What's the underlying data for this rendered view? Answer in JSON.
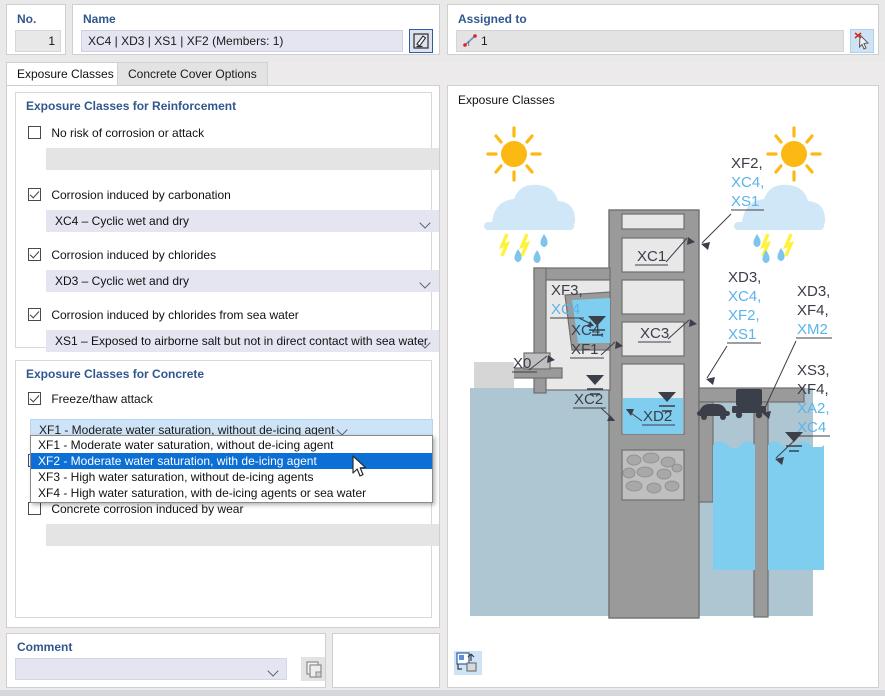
{
  "header": {
    "no_label": "No.",
    "no_value": "1",
    "name_label": "Name",
    "name_value": "XC4 | XD3 | XS1 | XF2 (Members: 1)",
    "name_edit_icon": "pencil-edit-icon",
    "assigned_label": "Assigned to",
    "assigned_value": "1",
    "assigned_member_icon": "member-line-icon",
    "assigned_pick_icon": "pick-cursor-icon"
  },
  "tabs": [
    {
      "label": "Exposure Classes",
      "active": true
    },
    {
      "label": "Concrete Cover Options",
      "active": false
    }
  ],
  "reinforcement_group": {
    "title": "Exposure Classes for Reinforcement",
    "items": [
      {
        "checkbox_label": "No risk of corrosion or attack",
        "checked": false,
        "value": "",
        "enabled": false
      },
      {
        "checkbox_label": "Corrosion induced by carbonation",
        "checked": true,
        "value": "XC4 – Cyclic wet and dry",
        "enabled": true
      },
      {
        "checkbox_label": "Corrosion induced by chlorides",
        "checked": true,
        "value": "XD3 – Cyclic wet and dry",
        "enabled": true
      },
      {
        "checkbox_label": "Corrosion induced by chlorides from sea water",
        "checked": true,
        "value": "XS1 – Exposed to airborne salt but not in direct contact with sea water",
        "enabled": true
      }
    ]
  },
  "concrete_group": {
    "title": "Exposure Classes for Concrete",
    "freeze": {
      "checkbox_label": "Freeze/thaw attack",
      "checked": true,
      "selected_value": "XF1 - Moderate water saturation, without de-icing agent",
      "dropdown_open": true,
      "options": [
        {
          "label": "XF1 - Moderate water saturation, without de-icing agent",
          "highlighted": false
        },
        {
          "label": "XF2 - Moderate water saturation, with de-icing agent",
          "highlighted": true
        },
        {
          "label": "XF3 - High water saturation, without de-icing agents",
          "highlighted": false
        },
        {
          "label": "XF4 - High water saturation, with de-icing agents or sea water",
          "highlighted": false
        }
      ]
    },
    "hidden_item": {
      "checkbox_label": "",
      "checked": false
    },
    "wear": {
      "checkbox_label": "Concrete corrosion induced by wear",
      "checked": false,
      "value": "",
      "enabled": false
    }
  },
  "comment": {
    "title": "Comment",
    "value": "",
    "copy_icon": "copy-pages-icon"
  },
  "right_panel": {
    "title": "Exposure Classes",
    "picture_button_icon": "image-export-icon"
  },
  "diagram": {
    "name": "exposure-classes-illustration",
    "annotations": [
      {
        "id": "ann-xf2-xc4-xs1",
        "lines": [
          "XF2,",
          "XC4,",
          "XS1"
        ],
        "colors": [
          "dark",
          "blue",
          "blue"
        ]
      },
      {
        "id": "ann-xc1",
        "lines": [
          "XC1"
        ],
        "colors": [
          "dark"
        ]
      },
      {
        "id": "ann-xc4-xf1",
        "lines": [
          "XC4,",
          "XF1"
        ],
        "colors": [
          "dark",
          "dark"
        ]
      },
      {
        "id": "ann-xf3-xc4",
        "lines": [
          "XF3,",
          "XC4"
        ],
        "colors": [
          "dark",
          "blue"
        ]
      },
      {
        "id": "ann-x0",
        "lines": [
          "X0"
        ],
        "colors": [
          "dark"
        ]
      },
      {
        "id": "ann-xc2",
        "lines": [
          "XC2"
        ],
        "colors": [
          "dark"
        ]
      },
      {
        "id": "ann-xc3",
        "lines": [
          "XC3"
        ],
        "colors": [
          "dark"
        ]
      },
      {
        "id": "ann-xd2",
        "lines": [
          "XD2"
        ],
        "colors": [
          "dark"
        ]
      },
      {
        "id": "ann-xd3-xc4-xf2-xs1",
        "lines": [
          "XD3,",
          "XC4,",
          "XF2,",
          "XS1"
        ],
        "colors": [
          "dark",
          "blue",
          "blue",
          "blue"
        ]
      },
      {
        "id": "ann-xd3-xf4-xm2",
        "lines": [
          "XD3,",
          "XF4,",
          "XM2"
        ],
        "colors": [
          "dark",
          "dark",
          "blue"
        ]
      },
      {
        "id": "ann-xs3-xf4-xa2-xc4",
        "lines": [
          "XS3,",
          "XF4,",
          "XA2,",
          "XC4"
        ],
        "colors": [
          "dark",
          "dark",
          "blue",
          "blue"
        ]
      }
    ],
    "colors": {
      "sun": "#FDB913",
      "cloud": "#CFE7F7",
      "rain": "#7FC4EB",
      "lightning": "#FFF23A",
      "concrete": "#9A9A9A",
      "room_fill": "#E8E8E8",
      "water_light": "#7FCDEF",
      "ground": "#AEC6D2",
      "label_blue": "#5AB4EA",
      "label_dark": "#3B3F4A"
    }
  }
}
